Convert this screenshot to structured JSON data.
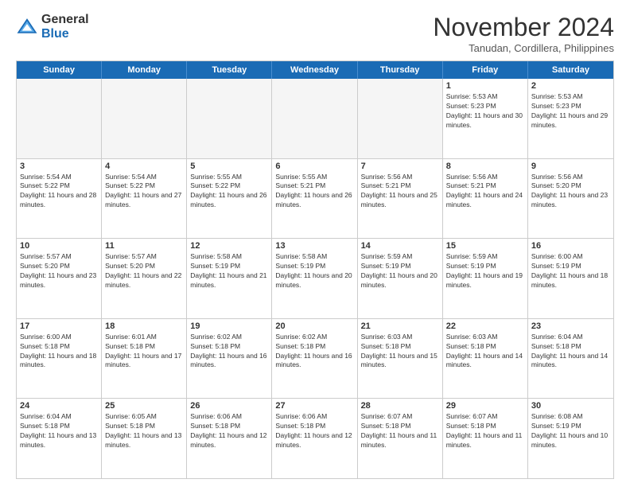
{
  "logo": {
    "general": "General",
    "blue": "Blue"
  },
  "title": "November 2024",
  "subtitle": "Tanudan, Cordillera, Philippines",
  "weekdays": [
    "Sunday",
    "Monday",
    "Tuesday",
    "Wednesday",
    "Thursday",
    "Friday",
    "Saturday"
  ],
  "weeks": [
    [
      {
        "day": "",
        "sunrise": "",
        "sunset": "",
        "daylight": "",
        "empty": true
      },
      {
        "day": "",
        "sunrise": "",
        "sunset": "",
        "daylight": "",
        "empty": true
      },
      {
        "day": "",
        "sunrise": "",
        "sunset": "",
        "daylight": "",
        "empty": true
      },
      {
        "day": "",
        "sunrise": "",
        "sunset": "",
        "daylight": "",
        "empty": true
      },
      {
        "day": "",
        "sunrise": "",
        "sunset": "",
        "daylight": "",
        "empty": true
      },
      {
        "day": "1",
        "sunrise": "Sunrise: 5:53 AM",
        "sunset": "Sunset: 5:23 PM",
        "daylight": "Daylight: 11 hours and 30 minutes.",
        "empty": false
      },
      {
        "day": "2",
        "sunrise": "Sunrise: 5:53 AM",
        "sunset": "Sunset: 5:23 PM",
        "daylight": "Daylight: 11 hours and 29 minutes.",
        "empty": false
      }
    ],
    [
      {
        "day": "3",
        "sunrise": "Sunrise: 5:54 AM",
        "sunset": "Sunset: 5:22 PM",
        "daylight": "Daylight: 11 hours and 28 minutes.",
        "empty": false
      },
      {
        "day": "4",
        "sunrise": "Sunrise: 5:54 AM",
        "sunset": "Sunset: 5:22 PM",
        "daylight": "Daylight: 11 hours and 27 minutes.",
        "empty": false
      },
      {
        "day": "5",
        "sunrise": "Sunrise: 5:55 AM",
        "sunset": "Sunset: 5:22 PM",
        "daylight": "Daylight: 11 hours and 26 minutes.",
        "empty": false
      },
      {
        "day": "6",
        "sunrise": "Sunrise: 5:55 AM",
        "sunset": "Sunset: 5:21 PM",
        "daylight": "Daylight: 11 hours and 26 minutes.",
        "empty": false
      },
      {
        "day": "7",
        "sunrise": "Sunrise: 5:56 AM",
        "sunset": "Sunset: 5:21 PM",
        "daylight": "Daylight: 11 hours and 25 minutes.",
        "empty": false
      },
      {
        "day": "8",
        "sunrise": "Sunrise: 5:56 AM",
        "sunset": "Sunset: 5:21 PM",
        "daylight": "Daylight: 11 hours and 24 minutes.",
        "empty": false
      },
      {
        "day": "9",
        "sunrise": "Sunrise: 5:56 AM",
        "sunset": "Sunset: 5:20 PM",
        "daylight": "Daylight: 11 hours and 23 minutes.",
        "empty": false
      }
    ],
    [
      {
        "day": "10",
        "sunrise": "Sunrise: 5:57 AM",
        "sunset": "Sunset: 5:20 PM",
        "daylight": "Daylight: 11 hours and 23 minutes.",
        "empty": false
      },
      {
        "day": "11",
        "sunrise": "Sunrise: 5:57 AM",
        "sunset": "Sunset: 5:20 PM",
        "daylight": "Daylight: 11 hours and 22 minutes.",
        "empty": false
      },
      {
        "day": "12",
        "sunrise": "Sunrise: 5:58 AM",
        "sunset": "Sunset: 5:19 PM",
        "daylight": "Daylight: 11 hours and 21 minutes.",
        "empty": false
      },
      {
        "day": "13",
        "sunrise": "Sunrise: 5:58 AM",
        "sunset": "Sunset: 5:19 PM",
        "daylight": "Daylight: 11 hours and 20 minutes.",
        "empty": false
      },
      {
        "day": "14",
        "sunrise": "Sunrise: 5:59 AM",
        "sunset": "Sunset: 5:19 PM",
        "daylight": "Daylight: 11 hours and 20 minutes.",
        "empty": false
      },
      {
        "day": "15",
        "sunrise": "Sunrise: 5:59 AM",
        "sunset": "Sunset: 5:19 PM",
        "daylight": "Daylight: 11 hours and 19 minutes.",
        "empty": false
      },
      {
        "day": "16",
        "sunrise": "Sunrise: 6:00 AM",
        "sunset": "Sunset: 5:19 PM",
        "daylight": "Daylight: 11 hours and 18 minutes.",
        "empty": false
      }
    ],
    [
      {
        "day": "17",
        "sunrise": "Sunrise: 6:00 AM",
        "sunset": "Sunset: 5:18 PM",
        "daylight": "Daylight: 11 hours and 18 minutes.",
        "empty": false
      },
      {
        "day": "18",
        "sunrise": "Sunrise: 6:01 AM",
        "sunset": "Sunset: 5:18 PM",
        "daylight": "Daylight: 11 hours and 17 minutes.",
        "empty": false
      },
      {
        "day": "19",
        "sunrise": "Sunrise: 6:02 AM",
        "sunset": "Sunset: 5:18 PM",
        "daylight": "Daylight: 11 hours and 16 minutes.",
        "empty": false
      },
      {
        "day": "20",
        "sunrise": "Sunrise: 6:02 AM",
        "sunset": "Sunset: 5:18 PM",
        "daylight": "Daylight: 11 hours and 16 minutes.",
        "empty": false
      },
      {
        "day": "21",
        "sunrise": "Sunrise: 6:03 AM",
        "sunset": "Sunset: 5:18 PM",
        "daylight": "Daylight: 11 hours and 15 minutes.",
        "empty": false
      },
      {
        "day": "22",
        "sunrise": "Sunrise: 6:03 AM",
        "sunset": "Sunset: 5:18 PM",
        "daylight": "Daylight: 11 hours and 14 minutes.",
        "empty": false
      },
      {
        "day": "23",
        "sunrise": "Sunrise: 6:04 AM",
        "sunset": "Sunset: 5:18 PM",
        "daylight": "Daylight: 11 hours and 14 minutes.",
        "empty": false
      }
    ],
    [
      {
        "day": "24",
        "sunrise": "Sunrise: 6:04 AM",
        "sunset": "Sunset: 5:18 PM",
        "daylight": "Daylight: 11 hours and 13 minutes.",
        "empty": false
      },
      {
        "day": "25",
        "sunrise": "Sunrise: 6:05 AM",
        "sunset": "Sunset: 5:18 PM",
        "daylight": "Daylight: 11 hours and 13 minutes.",
        "empty": false
      },
      {
        "day": "26",
        "sunrise": "Sunrise: 6:06 AM",
        "sunset": "Sunset: 5:18 PM",
        "daylight": "Daylight: 11 hours and 12 minutes.",
        "empty": false
      },
      {
        "day": "27",
        "sunrise": "Sunrise: 6:06 AM",
        "sunset": "Sunset: 5:18 PM",
        "daylight": "Daylight: 11 hours and 12 minutes.",
        "empty": false
      },
      {
        "day": "28",
        "sunrise": "Sunrise: 6:07 AM",
        "sunset": "Sunset: 5:18 PM",
        "daylight": "Daylight: 11 hours and 11 minutes.",
        "empty": false
      },
      {
        "day": "29",
        "sunrise": "Sunrise: 6:07 AM",
        "sunset": "Sunset: 5:18 PM",
        "daylight": "Daylight: 11 hours and 11 minutes.",
        "empty": false
      },
      {
        "day": "30",
        "sunrise": "Sunrise: 6:08 AM",
        "sunset": "Sunset: 5:19 PM",
        "daylight": "Daylight: 11 hours and 10 minutes.",
        "empty": false
      }
    ]
  ]
}
